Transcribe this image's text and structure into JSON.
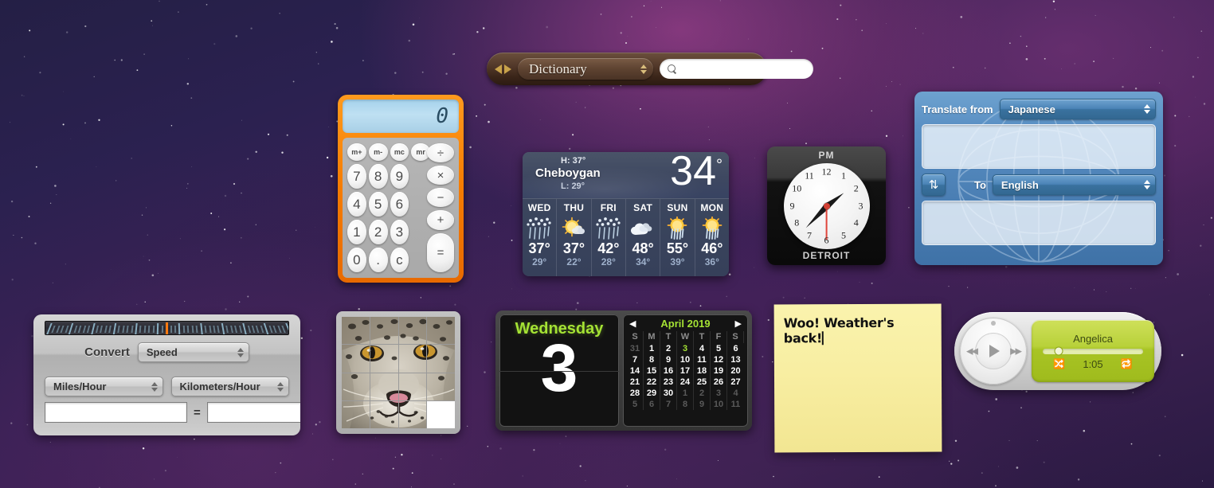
{
  "desktop": {
    "name": "macOS Dashboard"
  },
  "dictionary": {
    "name": "Dictionary widget",
    "source_label": "Dictionary",
    "search_value": "",
    "search_placeholder": "",
    "back_icon": "triangle-left-icon",
    "forward_icon": "triangle-right-icon",
    "search_icon": "magnifier-icon"
  },
  "calculator": {
    "name": "Calculator widget",
    "display": "0",
    "memory_keys": [
      "m+",
      "m-",
      "mc",
      "mr"
    ],
    "number_keys": [
      "7",
      "8",
      "9",
      "4",
      "5",
      "6",
      "1",
      "2",
      "3",
      "0",
      ".",
      "c"
    ],
    "op_keys": [
      "÷",
      "×",
      "−",
      "+",
      "="
    ],
    "accent_color": "#f57c00"
  },
  "weather": {
    "name": "Weather widget",
    "city": "Cheboygan",
    "current_temp": "34",
    "degree": "°",
    "high_label": "H: 37°",
    "low_label": "L: 29°",
    "forecast": [
      {
        "day": "WED",
        "icon": "snow-icon",
        "high": "37°",
        "low": "29°"
      },
      {
        "day": "THU",
        "icon": "sun-cloud-icon",
        "high": "37°",
        "low": "22°"
      },
      {
        "day": "FRI",
        "icon": "snow-icon",
        "high": "42°",
        "low": "28°"
      },
      {
        "day": "SAT",
        "icon": "cloud-icon",
        "high": "48°",
        "low": "34°"
      },
      {
        "day": "SUN",
        "icon": "sun-rain-icon",
        "high": "55°",
        "low": "39°"
      },
      {
        "day": "MON",
        "icon": "sun-rain-icon",
        "high": "46°",
        "low": "36°"
      }
    ]
  },
  "clock": {
    "name": "World Clock widget",
    "meridiem": "PM",
    "city": "DETROIT",
    "numerals": [
      "12",
      "1",
      "2",
      "3",
      "4",
      "5",
      "6",
      "7",
      "8",
      "9",
      "10",
      "11"
    ],
    "hour_angle_deg": 52,
    "minute_angle_deg": 224,
    "second_angle_deg": 180
  },
  "translate": {
    "name": "Translation widget",
    "from_label": "Translate from",
    "from_language": "Japanese",
    "to_label": "To",
    "to_language": "English",
    "source_text": "",
    "result_text": "",
    "swap_icon": "swap-arrows-icon"
  },
  "converter": {
    "name": "Unit Converter widget",
    "convert_label": "Convert",
    "category": "Speed",
    "from_unit": "Miles/Hour",
    "to_unit": "Kilometers/Hour",
    "from_value": "",
    "to_value": "",
    "equals_label": "="
  },
  "puzzle": {
    "name": "Tile Game widget",
    "image_subject": "snow-leopard",
    "grid": "4x4",
    "empty_tile_index": 15
  },
  "calendar": {
    "name": "Calendar widget",
    "weekday": "Wednesday",
    "day_number": "3",
    "month_title": "April 2019",
    "prev_icon": "triangle-left-icon",
    "next_icon": "triangle-right-icon",
    "day_headers": [
      "S",
      "M",
      "T",
      "W",
      "T",
      "F",
      "S"
    ],
    "weeks": [
      [
        {
          "n": "31",
          "dim": true
        },
        {
          "n": "1"
        },
        {
          "n": "2"
        },
        {
          "n": "3",
          "today": true
        },
        {
          "n": "4"
        },
        {
          "n": "5"
        },
        {
          "n": "6"
        }
      ],
      [
        {
          "n": "7"
        },
        {
          "n": "8"
        },
        {
          "n": "9"
        },
        {
          "n": "10"
        },
        {
          "n": "11"
        },
        {
          "n": "12"
        },
        {
          "n": "13"
        }
      ],
      [
        {
          "n": "14"
        },
        {
          "n": "15"
        },
        {
          "n": "16"
        },
        {
          "n": "17"
        },
        {
          "n": "18"
        },
        {
          "n": "19"
        },
        {
          "n": "20"
        }
      ],
      [
        {
          "n": "21"
        },
        {
          "n": "22"
        },
        {
          "n": "23"
        },
        {
          "n": "24"
        },
        {
          "n": "25"
        },
        {
          "n": "26"
        },
        {
          "n": "27"
        }
      ],
      [
        {
          "n": "28"
        },
        {
          "n": "29"
        },
        {
          "n": "30"
        },
        {
          "n": "1",
          "dim": true
        },
        {
          "n": "2",
          "dim": true
        },
        {
          "n": "3",
          "dim": true
        },
        {
          "n": "4",
          "dim": true
        }
      ],
      [
        {
          "n": "5",
          "dim": true
        },
        {
          "n": "6",
          "dim": true
        },
        {
          "n": "7",
          "dim": true
        },
        {
          "n": "8",
          "dim": true
        },
        {
          "n": "9",
          "dim": true
        },
        {
          "n": "10",
          "dim": true
        },
        {
          "n": "11",
          "dim": true
        }
      ]
    ],
    "today_color": "#a4e234"
  },
  "sticky": {
    "name": "Stickies widget",
    "text": "Woo! Weather's back!",
    "paper_color": "#f8eea2"
  },
  "itunes": {
    "name": "iTunes widget",
    "track_title": "Angelica",
    "elapsed_time": "1:05",
    "play_icon": "play-icon",
    "previous_icon": "rewind-icon",
    "next_icon": "fast-forward-icon",
    "shuffle_icon": "shuffle-icon",
    "repeat_icon": "repeat-icon",
    "screen_color": "#b8d13a",
    "progress_percent": 16
  }
}
